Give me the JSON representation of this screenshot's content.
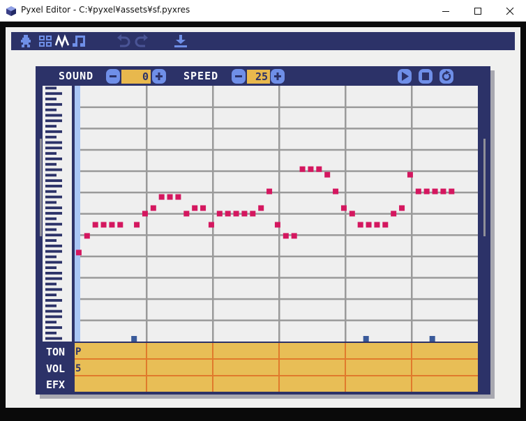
{
  "window": {
    "title": "Pyxel Editor - C:\\pyxel\\assets\\sf.pyxres",
    "title_display": "Pyxel Editor - C:¥pyxel¥assets¥sf.pyxres"
  },
  "toolbar": {
    "tools": [
      "image-editor-icon",
      "tilemap-editor-icon",
      "sound-editor-icon",
      "music-editor-icon"
    ],
    "undo_icon": "undo-icon",
    "redo_icon": "redo-icon",
    "save_icon": "save-icon"
  },
  "sound_panel": {
    "sound_label": "SOUND",
    "sound_value": "0",
    "speed_label": "SPEED",
    "speed_value": "25",
    "play_icon": "play-icon",
    "stop_icon": "stop-icon",
    "loop_icon": "loop-icon"
  },
  "rows": {
    "tone_label": "TON",
    "volume_label": "VOL",
    "effect_label": "EFX",
    "tone_value": "P",
    "volume_value": "5",
    "effect_value": ""
  },
  "note_data": {
    "notes": [
      28,
      31,
      33,
      33,
      33,
      33,
      -1,
      33,
      35,
      36,
      38,
      38,
      38,
      35,
      36,
      36,
      33,
      35,
      35,
      35,
      35,
      35,
      36,
      39,
      33,
      31,
      31,
      43,
      43,
      43,
      42,
      39,
      36,
      35,
      33,
      33,
      33,
      33,
      35,
      36,
      42,
      39,
      39,
      39,
      39,
      39
    ],
    "note_min": 12,
    "note_max": 58,
    "rest_markers": [
      6,
      34,
      42
    ],
    "length": 48
  },
  "colors": {
    "frame": "#2c3268",
    "note": "#d4175f",
    "grid_bg": "#efefef",
    "grid_line": "#9a9a9a",
    "cursor": "#a9c6f6",
    "row_bg": "#e8be56",
    "row_line": "#e07a2c"
  }
}
